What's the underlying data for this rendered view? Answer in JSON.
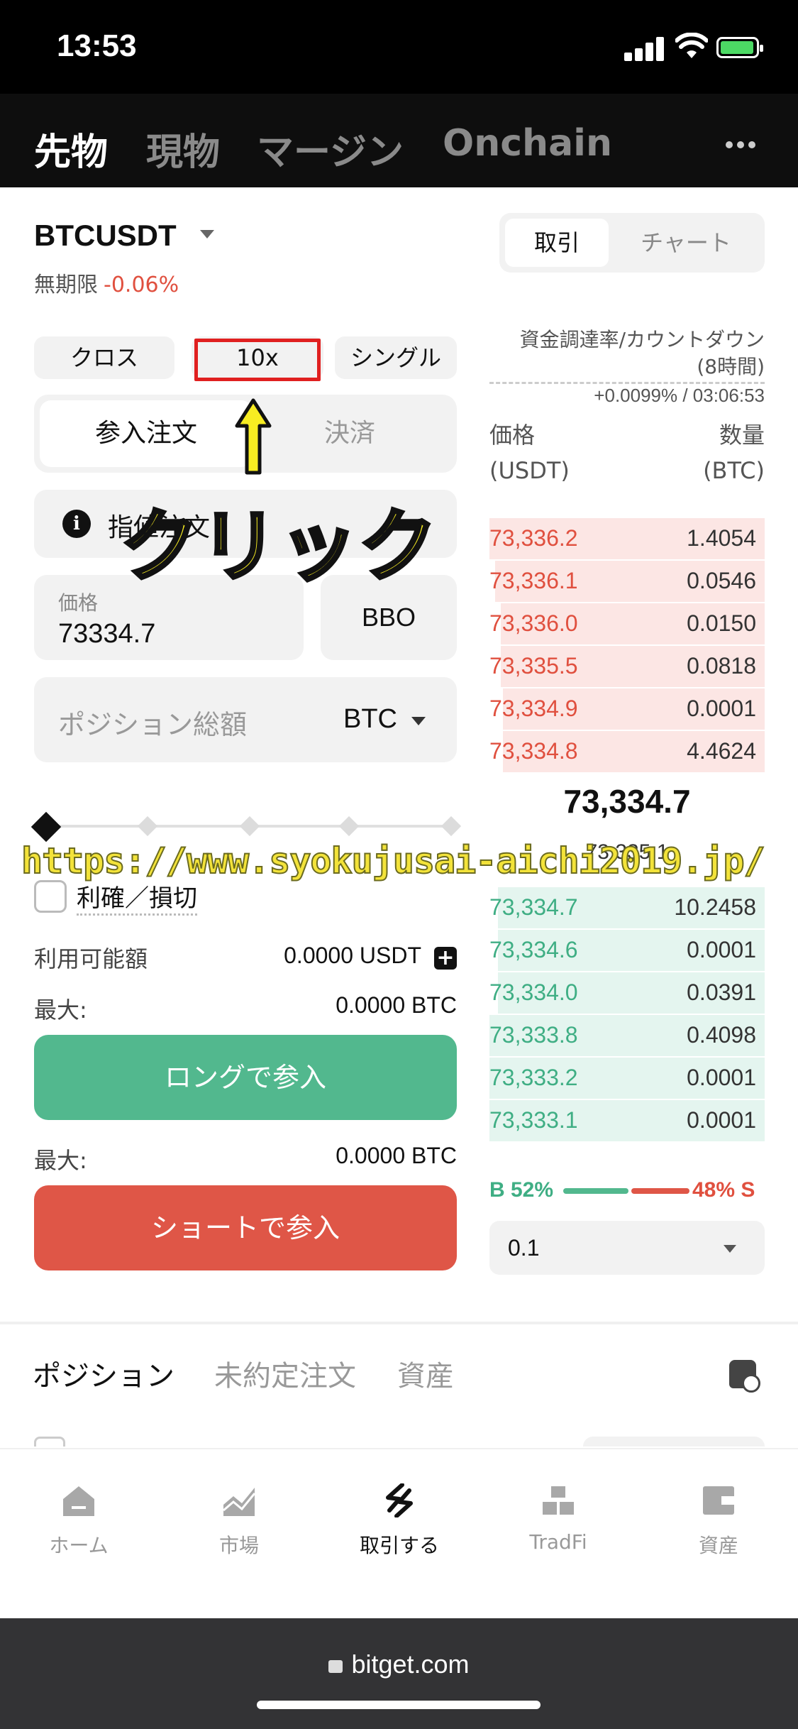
{
  "status_bar": {
    "time": "13:53"
  },
  "market_tabs": [
    {
      "label": "先物",
      "active": true
    },
    {
      "label": "現物",
      "active": false
    },
    {
      "label": "マージン",
      "active": false
    },
    {
      "label": "Onchain",
      "active": false
    }
  ],
  "header": {
    "symbol": "BTCUSDT",
    "contract_type": "無期限",
    "change": "-0.06%",
    "view_toggle": {
      "trade": "取引",
      "chart": "チャート"
    }
  },
  "order_form": {
    "margin_mode": "クロス",
    "leverage": "10x",
    "position_mode": "シングル",
    "tab_open": "参入注文",
    "tab_close": "決済",
    "order_type": "指値注文",
    "price_label": "価格",
    "price_value": "73334.7",
    "bbo_label": "BBO",
    "size_placeholder": "ポジション総額",
    "size_unit": "BTC",
    "slider_level": 0,
    "tpsl_label": "利確／損切",
    "available_label": "利用可能額",
    "available_value": "0.0000 USDT",
    "max_label_1": "最大:",
    "max_value_1": "0.0000 BTC",
    "long_button": "ロングで参入",
    "max_label_2": "最大:",
    "max_value_2": "0.0000 BTC",
    "short_button": "ショートで参入"
  },
  "order_book": {
    "funding_label": "資金調達率/カウントダウン",
    "funding_interval": "(8時間)",
    "funding_value": "+0.0099% / 03:06:53",
    "price_header": "価格",
    "price_unit": "(USDT)",
    "qty_header": "数量",
    "qty_unit": "(BTC)",
    "asks": [
      {
        "price": "73,336.2",
        "qty": "1.4054",
        "depth": 1.0
      },
      {
        "price": "73,336.1",
        "qty": "0.0546",
        "depth": 0.98
      },
      {
        "price": "73,336.0",
        "qty": "0.0150",
        "depth": 0.96
      },
      {
        "price": "73,335.5",
        "qty": "0.0818",
        "depth": 0.96
      },
      {
        "price": "73,334.9",
        "qty": "0.0001",
        "depth": 0.95
      },
      {
        "price": "73,334.8",
        "qty": "4.4624",
        "depth": 0.95
      }
    ],
    "last_price": "73,334.7",
    "mark_price": "73,335.1",
    "bids": [
      {
        "price": "73,334.7",
        "qty": "10.2458",
        "depth": 0.97
      },
      {
        "price": "73,334.6",
        "qty": "0.0001",
        "depth": 0.97
      },
      {
        "price": "73,334.0",
        "qty": "0.0391",
        "depth": 0.97
      },
      {
        "price": "73,333.8",
        "qty": "0.4098",
        "depth": 1.0
      },
      {
        "price": "73,333.2",
        "qty": "0.0001",
        "depth": 1.0
      },
      {
        "price": "73,333.1",
        "qty": "0.0001",
        "depth": 1.0
      }
    ],
    "buy_ratio": "B 52%",
    "sell_ratio": "48% S",
    "depth_value": "0.1"
  },
  "annotation": {
    "click_text": "クリック",
    "watermark": "https://www.syokujusai-aichi2019.jp/"
  },
  "positions_tabs": [
    {
      "label": "ポジション",
      "active": true
    },
    {
      "label": "未約定注文",
      "active": false
    },
    {
      "label": "資産",
      "active": false
    }
  ],
  "bottom_nav": [
    {
      "label": "ホーム",
      "icon": "home-icon",
      "active": false
    },
    {
      "label": "市場",
      "icon": "market-chart-icon",
      "active": false
    },
    {
      "label": "取引する",
      "icon": "trade-icon",
      "active": true
    },
    {
      "label": "TradFi",
      "icon": "gold-bars-icon",
      "active": false
    },
    {
      "label": "資産",
      "icon": "wallet-icon",
      "active": false
    }
  ],
  "browser": {
    "url": "bitget.com"
  },
  "colors": {
    "ask": "#e0503f",
    "bid": "#3fae84",
    "long": "#52b88e",
    "short": "#df5647",
    "highlight": "#e02020",
    "annotation": "#f7ec22"
  }
}
